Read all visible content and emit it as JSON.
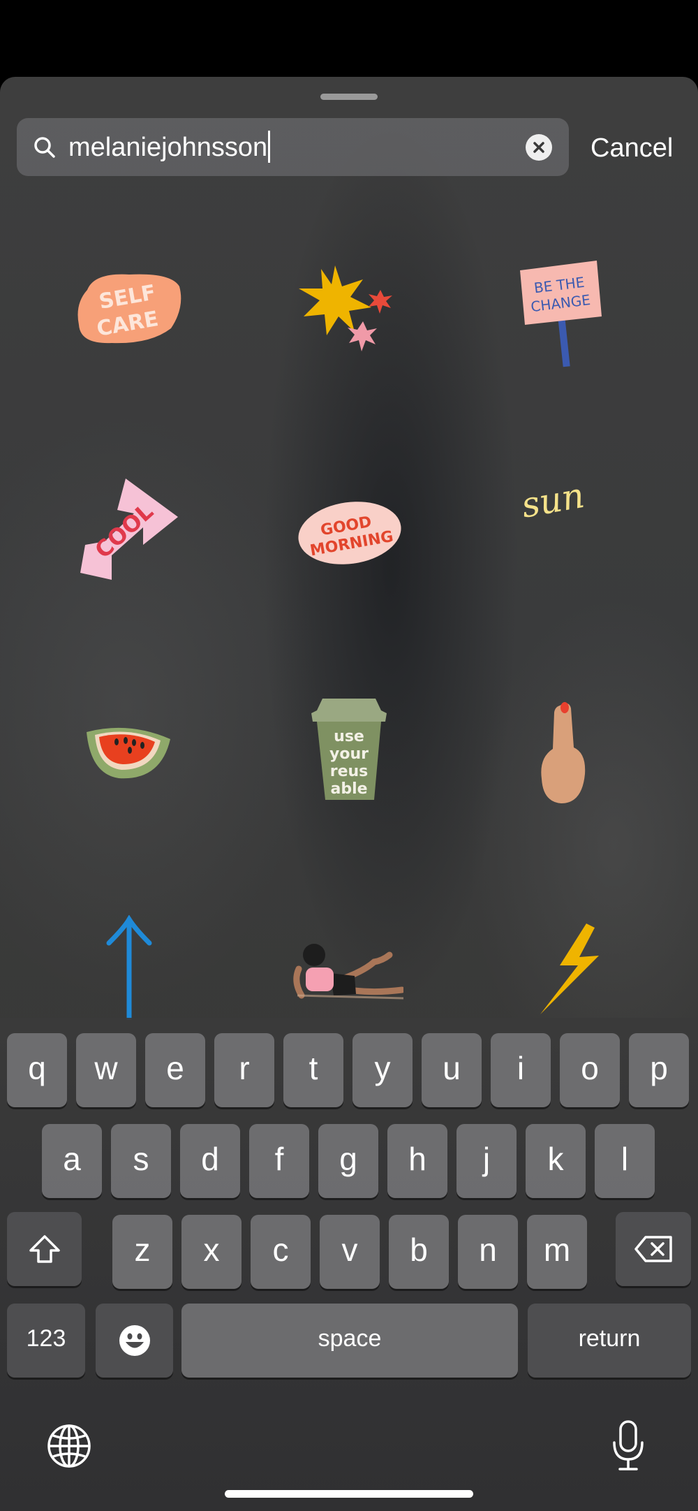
{
  "search": {
    "value": "melaniejohnsson",
    "cancel_label": "Cancel"
  },
  "stickers": [
    {
      "name": "self-care-sticker",
      "text": "SELF CARE"
    },
    {
      "name": "starburst-sticker",
      "text": ""
    },
    {
      "name": "be-the-change-sticker",
      "text": "BE THE CHANGE"
    },
    {
      "name": "cool-arrow-sticker",
      "text": "COOL"
    },
    {
      "name": "good-morning-sticker",
      "text": "GOOD MORNING"
    },
    {
      "name": "sun-sticker",
      "text": "sun"
    },
    {
      "name": "watermelon-sticker",
      "text": ""
    },
    {
      "name": "reusable-cup-sticker",
      "text": "use your reus able"
    },
    {
      "name": "pointing-hand-sticker",
      "text": ""
    },
    {
      "name": "up-arrow-sticker",
      "text": ""
    },
    {
      "name": "exercising-woman-sticker",
      "text": ""
    },
    {
      "name": "lightning-bolt-sticker",
      "text": ""
    }
  ],
  "keyboard": {
    "row1": [
      "q",
      "w",
      "e",
      "r",
      "t",
      "y",
      "u",
      "i",
      "o",
      "p"
    ],
    "row2": [
      "a",
      "s",
      "d",
      "f",
      "g",
      "h",
      "j",
      "k",
      "l"
    ],
    "row3": [
      "z",
      "x",
      "c",
      "v",
      "b",
      "n",
      "m"
    ],
    "numbers_label": "123",
    "space_label": "space",
    "return_label": "return"
  },
  "colors": {
    "accent_orange": "#f7a078",
    "accent_yellow": "#f0b400",
    "accent_blue": "#1f8ad8"
  }
}
